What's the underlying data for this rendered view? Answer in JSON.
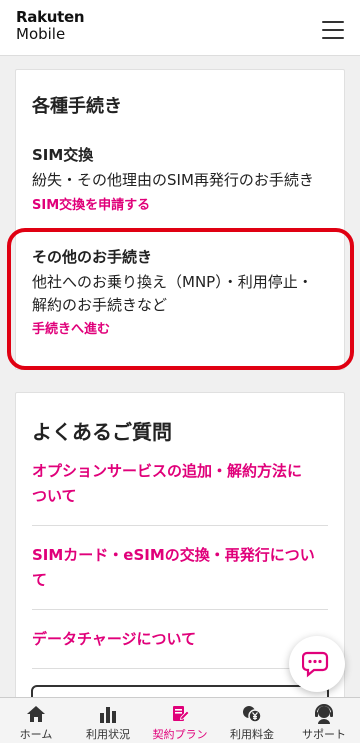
{
  "header": {
    "logo_line1": "Rakuten",
    "logo_line2": "Mobile"
  },
  "procedures": {
    "title": "各種手続き",
    "sim_exchange": {
      "heading": "SIM交換",
      "description": "紛失・その他理由のSIM再発行のお手続き",
      "link": "SIM交換を申請する"
    },
    "other": {
      "heading": "その他のお手続き",
      "description_line1": "他社へのお乗り換え（MNP）・利用停止・",
      "description_line2": "解約のお手続きなど",
      "link": "手続きへ進む"
    }
  },
  "faq": {
    "title": "よくあるご質問",
    "items": [
      {
        "line1": "オプションサービスの追加・解約方法に",
        "line2": "ついて"
      },
      {
        "line1": "SIMカード・eSIMの交換・再発行につい",
        "line2": "て"
      },
      {
        "line1": "データチャージについて",
        "line2": ""
      }
    ]
  },
  "bottom_nav": {
    "items": [
      {
        "label": "ホーム",
        "icon": "home-icon",
        "active": false
      },
      {
        "label": "利用状況",
        "icon": "bar-chart-icon",
        "active": false
      },
      {
        "label": "契約プラン",
        "icon": "contract-icon",
        "active": true
      },
      {
        "label": "利用料金",
        "icon": "yen-icon",
        "active": false
      },
      {
        "label": "サポート",
        "icon": "support-icon",
        "active": false
      }
    ]
  },
  "colors": {
    "accent": "#e0007a",
    "highlight": "#e00012"
  }
}
